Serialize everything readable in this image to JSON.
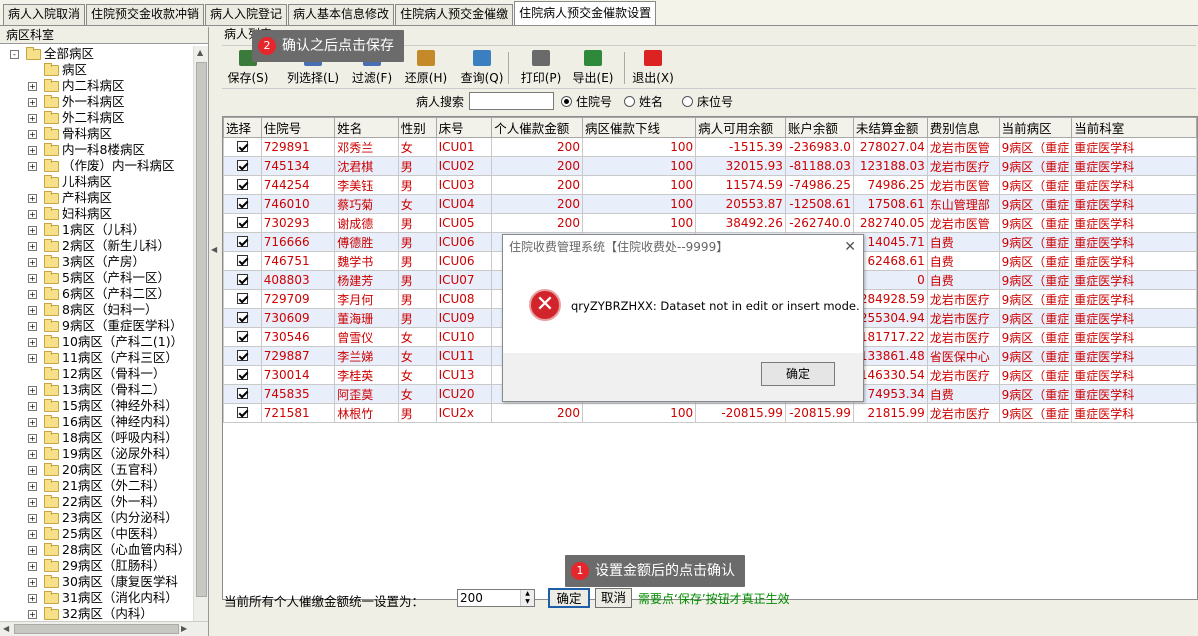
{
  "tabs": [
    "病人入院取消",
    "住院预交金收款冲销",
    "病人入院登记",
    "病人基本信息修改",
    "住院病人预交金催缴",
    "住院病人预交金催款设置"
  ],
  "active_tab": 5,
  "left_panel": {
    "title": "病区科室",
    "tree": [
      {
        "label": "全部病区",
        "level": 0,
        "expand": "-"
      },
      {
        "label": "病区",
        "level": 1,
        "expand": ""
      },
      {
        "label": "内二科病区",
        "level": 1,
        "expand": "+"
      },
      {
        "label": "外一科病区",
        "level": 1,
        "expand": "+"
      },
      {
        "label": "外二科病区",
        "level": 1,
        "expand": "+"
      },
      {
        "label": "骨科病区",
        "level": 1,
        "expand": "+"
      },
      {
        "label": "内一科8楼病区",
        "level": 1,
        "expand": "+"
      },
      {
        "label": "（作废）内一科病区",
        "level": 1,
        "expand": "+"
      },
      {
        "label": "儿科病区",
        "level": 1,
        "expand": ""
      },
      {
        "label": "产科病区",
        "level": 1,
        "expand": "+"
      },
      {
        "label": "妇科病区",
        "level": 1,
        "expand": "+"
      },
      {
        "label": "1病区（儿科）",
        "level": 1,
        "expand": "+"
      },
      {
        "label": "2病区（新生儿科）",
        "level": 1,
        "expand": "+"
      },
      {
        "label": "3病区（产房）",
        "level": 1,
        "expand": "+"
      },
      {
        "label": "5病区（产科一区）",
        "level": 1,
        "expand": "+"
      },
      {
        "label": "6病区（产科二区）",
        "level": 1,
        "expand": "+"
      },
      {
        "label": "8病区（妇科一）",
        "level": 1,
        "expand": "+"
      },
      {
        "label": "9病区（重症医学科）",
        "level": 1,
        "expand": "+",
        "open": true
      },
      {
        "label": "10病区（产科二(1)）",
        "level": 1,
        "expand": "+"
      },
      {
        "label": "11病区（产科三区）",
        "level": 1,
        "expand": "+"
      },
      {
        "label": "12病区（骨科一）",
        "level": 1,
        "expand": ""
      },
      {
        "label": "13病区（骨科二）",
        "level": 1,
        "expand": "+"
      },
      {
        "label": "15病区（神经外科）",
        "level": 1,
        "expand": "+"
      },
      {
        "label": "16病区（神经内科）",
        "level": 1,
        "expand": "+"
      },
      {
        "label": "18病区（呼吸内科）",
        "level": 1,
        "expand": "+"
      },
      {
        "label": "19病区（泌尿外科）",
        "level": 1,
        "expand": "+"
      },
      {
        "label": "20病区（五官科）",
        "level": 1,
        "expand": "+"
      },
      {
        "label": "21病区（外二科）",
        "level": 1,
        "expand": "+"
      },
      {
        "label": "22病区（外一科）",
        "level": 1,
        "expand": "+"
      },
      {
        "label": "23病区（内分泌科）",
        "level": 1,
        "expand": "+"
      },
      {
        "label": "25病区（中医科）",
        "level": 1,
        "expand": "+"
      },
      {
        "label": "28病区（心血管内科）",
        "level": 1,
        "expand": "+"
      },
      {
        "label": "29病区（肛肠科）",
        "level": 1,
        "expand": "+"
      },
      {
        "label": "30病区（康复医学科",
        "level": 1,
        "expand": "+"
      },
      {
        "label": "31病区（消化内科）",
        "level": 1,
        "expand": "+"
      },
      {
        "label": "32病区（内科）",
        "level": 1,
        "expand": "+"
      }
    ]
  },
  "main": {
    "list_title": "病人列表",
    "toolbar": [
      {
        "label": "保存(S)",
        "icon": "save-icon",
        "color": "#3a7a3a"
      },
      {
        "label": "列选择(L)",
        "icon": "columns-icon",
        "color": "#4a6fb3"
      },
      {
        "label": "过滤(F)",
        "icon": "filter-icon",
        "color": "#4a6fb3"
      },
      {
        "label": "还原(H)",
        "icon": "restore-icon",
        "color": "#c48a2a"
      },
      {
        "label": "查询(Q)",
        "icon": "refresh-icon",
        "color": "#3c7fc0"
      },
      {
        "label": "打印(P)",
        "icon": "printer-icon",
        "color": "#6a6a6a"
      },
      {
        "label": "导出(E)",
        "icon": "excel-icon",
        "color": "#2e8a3a"
      },
      {
        "label": "退出(X)",
        "icon": "exit-icon",
        "color": "#d22"
      }
    ],
    "search": {
      "label": "病人搜索",
      "value": "",
      "options": [
        "住院号",
        "姓名",
        "床位号"
      ],
      "selected": 0
    },
    "columns": [
      "选择",
      "住院号",
      "姓名",
      "性别",
      "床号",
      "个人催款金额",
      "病区催款下线",
      "病人可用余额",
      "账户余额",
      "未结算金额",
      "费别信息",
      "当前病区",
      "当前科室"
    ],
    "rows": [
      [
        "729891",
        "邓秀兰",
        "女",
        "ICU01",
        "200",
        "100",
        "-1515.39",
        "-236983.0",
        "278027.04",
        "龙岩市医管",
        "9病区（重症",
        "重症医学科"
      ],
      [
        "745134",
        "沈君棋",
        "男",
        "ICU02",
        "200",
        "100",
        "32015.93",
        "-81188.03",
        "123188.03",
        "龙岩市医疗",
        "9病区（重症",
        "重症医学科"
      ],
      [
        "744254",
        "李美钰",
        "男",
        "ICU03",
        "200",
        "100",
        "11574.59",
        "-74986.25",
        "74986.25",
        "龙岩市医管",
        "9病区（重症",
        "重症医学科"
      ],
      [
        "746010",
        "蔡巧菊",
        "女",
        "ICU04",
        "200",
        "100",
        "20553.87",
        "-12508.61",
        "17508.61",
        "东山管理部",
        "9病区（重症",
        "重症医学科"
      ],
      [
        "730293",
        "谢成德",
        "男",
        "ICU05",
        "200",
        "100",
        "38492.26",
        "-262740.0",
        "282740.05",
        "龙岩市医管",
        "9病区（重症",
        "重症医学科"
      ],
      [
        "716666",
        "傅德胜",
        "男",
        "ICU06",
        "",
        "",
        "",
        "",
        "14045.71",
        "自费",
        "9病区（重症",
        "重症医学科"
      ],
      [
        "746751",
        "魏学书",
        "男",
        "ICU06",
        "",
        "",
        "",
        "",
        "62468.61",
        "自费",
        "9病区（重症",
        "重症医学科"
      ],
      [
        "408803",
        "杨建芳",
        "男",
        "ICU07",
        "",
        "",
        "",
        "",
        "0",
        "自费",
        "9病区（重症",
        "重症医学科"
      ],
      [
        "729709",
        "李月何",
        "男",
        "ICU08",
        "",
        "",
        "",
        "",
        "284928.59",
        "龙岩市医疗",
        "9病区（重症",
        "重症医学科"
      ],
      [
        "730609",
        "董海珊",
        "男",
        "ICU09",
        "",
        "",
        "",
        "",
        "255304.94",
        "龙岩市医疗",
        "9病区（重症",
        "重症医学科"
      ],
      [
        "730546",
        "曾雪仪",
        "女",
        "ICU10",
        "",
        "",
        "",
        "",
        "181717.22",
        "龙岩市医疗",
        "9病区（重症",
        "重症医学科"
      ],
      [
        "729887",
        "李兰娣",
        "女",
        "ICU11",
        "",
        "",
        "",
        "",
        "133861.48",
        "省医保中心",
        "9病区（重症",
        "重症医学科"
      ],
      [
        "730014",
        "李桂英",
        "女",
        "ICU13",
        "",
        "",
        "",
        "",
        "146330.54",
        "龙岩市医疗",
        "9病区（重症",
        "重症医学科"
      ],
      [
        "745835",
        "阿歪莫",
        "女",
        "ICU20",
        "",
        "",
        "",
        "",
        "74953.34",
        "自费",
        "9病区（重症",
        "重症医学科"
      ],
      [
        "721581",
        "林根竹",
        "男",
        "ICU2x",
        "200",
        "100",
        "-20815.99",
        "-20815.99",
        "21815.99",
        "龙岩市医疗",
        "9病区（重症",
        "重症医学科"
      ]
    ],
    "bottom": {
      "label": "当前所有个人催缴金额统一设置为：",
      "value": "200",
      "confirm_label": "确定",
      "cancel_label": "取消",
      "hint": "需要点‘保存’按钮才真正生效"
    }
  },
  "dialog": {
    "title": "住院收费管理系统【住院收费处--9999】",
    "message": "qryZYBRZHXX: Dataset not in edit or insert mode.",
    "ok_label": "确定"
  },
  "callouts": [
    {
      "num": "2",
      "text": "确认之后点击保存"
    },
    {
      "num": "1",
      "text": "设置金额后的点击确认"
    }
  ]
}
